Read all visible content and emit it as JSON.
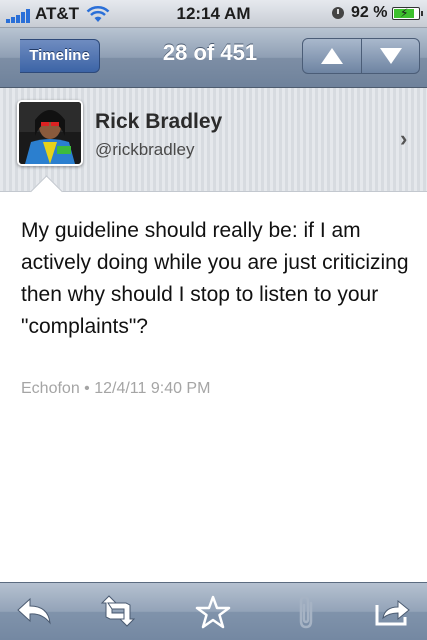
{
  "status_bar": {
    "carrier": "AT&T",
    "time": "12:14 AM",
    "battery_percent": "92 %",
    "battery_level": 0.92,
    "icons": [
      "signal-icon",
      "wifi-icon",
      "clock-icon",
      "battery-icon"
    ]
  },
  "nav": {
    "back_label": "Timeline",
    "title": "28 of 451",
    "up_icon": "up-arrow-icon",
    "down_icon": "down-arrow-icon"
  },
  "profile": {
    "name": "Rick Bradley",
    "handle": "@rickbradley",
    "chevron_icon": "chevron-right-icon"
  },
  "tweet": {
    "text": "My guideline should really be: if I am actively doing while you are just criticizing then why should I stop to listen to your \"complaints\"?",
    "meta": "Echofon • 12/4/11 9:40 PM"
  },
  "toolbar": {
    "buttons": [
      "reply-icon",
      "retweet-icon",
      "favorite-icon",
      "attach-icon",
      "share-icon"
    ]
  },
  "colors": {
    "nav_bar": "#8495ab",
    "back_button": "#4a6fae",
    "meta_text": "#a5a5a5"
  }
}
